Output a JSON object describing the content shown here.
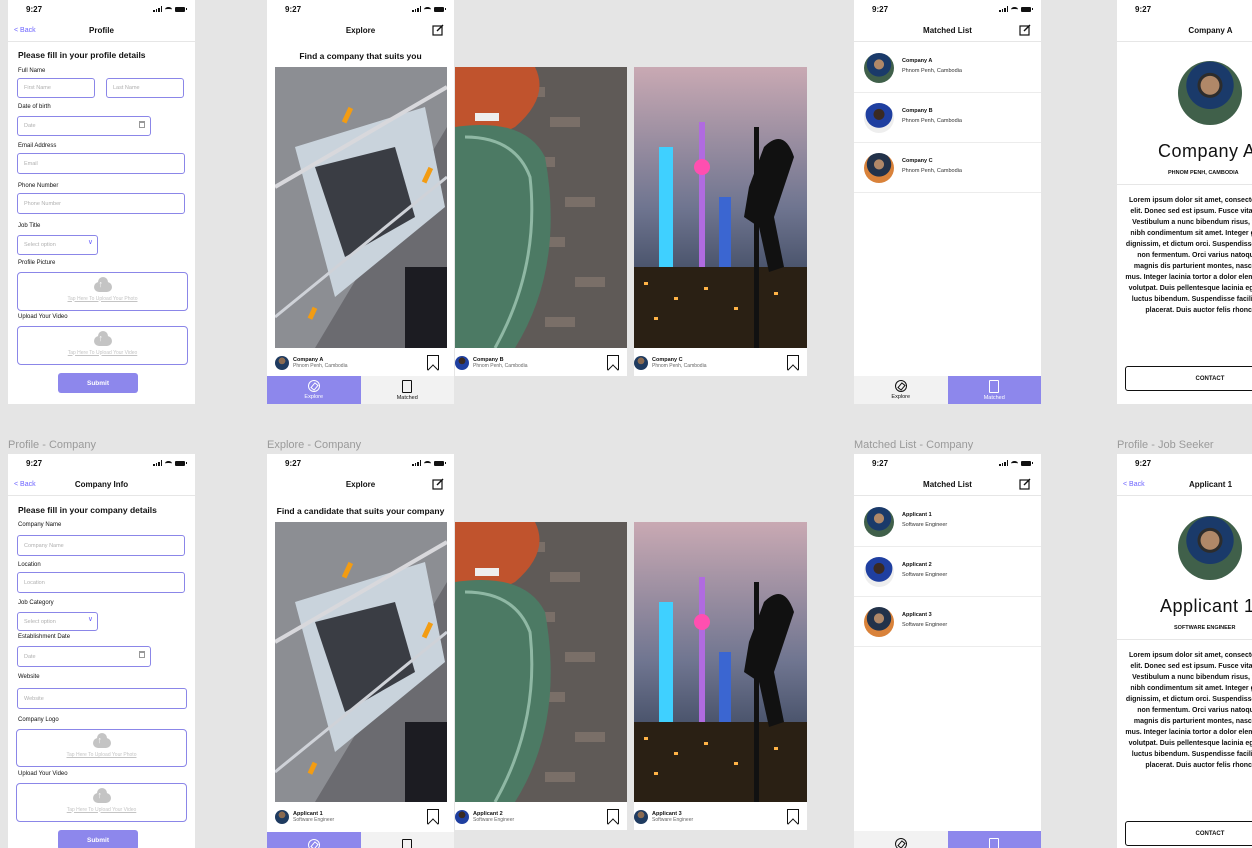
{
  "colors": {
    "accent": "#8d87ec",
    "canvas": "#e5e5e5",
    "label": "#9a9a9a"
  },
  "status_time": "9:27",
  "frame_labels": {
    "profile_company": "Profile - Company",
    "explore_company": "Explore - Company",
    "matched_company": "Matched List - Company",
    "profile_seeker": "Profile - Job Seeker"
  },
  "profile_form": {
    "back": "< Back",
    "title": "Profile",
    "heading": "Please fill in your profile details",
    "full_name_label": "Full Name",
    "first_name_ph": "First Name",
    "last_name_ph": "Last Name",
    "dob_label": "Date of birth",
    "date_ph": "Date",
    "email_label": "Email Address",
    "email_ph": "Email",
    "phone_label": "Phone Number",
    "phone_ph": "Phone Number",
    "job_title_label": "Job Title",
    "select_ph": "Select option",
    "picture_label": "Profile Picture",
    "upload_photo": "Tap Here To Upload Your Photo",
    "video_label": "Upload Your Video",
    "upload_video": "Tap Here To Upload Your Video",
    "submit": "Submit"
  },
  "company_form": {
    "back": "< Back",
    "title": "Company Info",
    "heading": "Please fill in your company details",
    "company_name_label": "Company Name",
    "company_name_ph": "Company Name",
    "location_label": "Location",
    "location_ph": "Location",
    "category_label": "Job Category",
    "select_ph": "Select option",
    "established_label": "Establishment Date",
    "date_ph": "Date",
    "website_label": "Website",
    "website_ph": "Website",
    "logo_label": "Company Logo",
    "upload_photo": "Tap Here To Upload Your Photo",
    "video_label": "Upload Your Video",
    "upload_video": "Tap Here To Upload Your Video",
    "submit": "Submit"
  },
  "explore_top": {
    "title": "Explore",
    "heading": "Find a company that suits you",
    "cards": [
      {
        "name": "Company A",
        "sub": "Phnom Penh, Cambodia"
      },
      {
        "name": "Company B",
        "sub": "Phnom Penh, Cambodia"
      },
      {
        "name": "Company C",
        "sub": "Phnom Penh, Cambodia"
      }
    ],
    "tabs": [
      "Explore",
      "Matched"
    ]
  },
  "explore_bottom": {
    "title": "Explore",
    "heading": "Find a candidate that suits your company",
    "cards": [
      {
        "name": "Applicant 1",
        "sub": "Software Engineer"
      },
      {
        "name": "Applicant 2",
        "sub": "Software Engineer"
      },
      {
        "name": "Applicant 3",
        "sub": "Software Engineer"
      }
    ]
  },
  "matched_top": {
    "title": "Matched List",
    "rows": [
      {
        "name": "Company A",
        "sub": "Phnom Penh, Cambodia"
      },
      {
        "name": "Company B",
        "sub": "Phnom Penh, Cambodia"
      },
      {
        "name": "Company C",
        "sub": "Phnom Penh, Cambodia"
      }
    ],
    "tabs": [
      "Explore",
      "Matched"
    ]
  },
  "matched_bottom": {
    "title": "Matched List",
    "rows": [
      {
        "name": "Applicant 1",
        "sub": "Software Engineer"
      },
      {
        "name": "Applicant 2",
        "sub": "Software Engineer"
      },
      {
        "name": "Applicant 3",
        "sub": "Software Engineer"
      }
    ]
  },
  "detail_top": {
    "title": "Company A",
    "big_name": "Company A",
    "sub": "PHNOM PENH, CAMBODIA",
    "lorem": "Lorem ipsum dolor sit amet, consectetur adipiscing elit. Donec sed est ipsum. Fusce vitae viverra ante. Vestibulum a nunc bibendum risus, vitae vehicula nibh condimentum sit amet. Integer gravida sapien dignissim, et dictum orci. Suspendisse pretium lorem non fermentum. Orci varius natoque penatibus magnis dis parturient montes, nascetur ridiculus mus. Integer lacinia tortor a dolor elementum, fringilla volutpat. Duis pellentesque lacinia egestas vehicula luctus bibendum. Suspendisse facilisis id dolor id placerat. Duis auctor felis rhoncus luctus.",
    "contact": "CONTACT"
  },
  "detail_bottom": {
    "back": "< Back",
    "title": "Applicant 1",
    "big_name": "Applicant 1",
    "sub": "SOFTWARE ENGINEER",
    "lorem": "Lorem ipsum dolor sit amet, consectetur adipiscing elit. Donec sed est ipsum. Fusce vitae viverra ante. Vestibulum a nunc bibendum risus, vitae vehicula nibh condimentum sit amet. Integer gravida sapien dignissim, et dictum orci. Suspendisse pretium lorem non fermentum. Orci varius natoque penatibus magnis dis parturient montes, nascetur ridiculus mus. Integer lacinia tortor a dolor elementum, fringilla volutpat. Duis pellentesque lacinia egestas vehicula luctus bibendum. Suspendisse facilisis id dolor id placerat. Duis auctor felis rhoncus luctus.",
    "contact": "CONTACT"
  }
}
